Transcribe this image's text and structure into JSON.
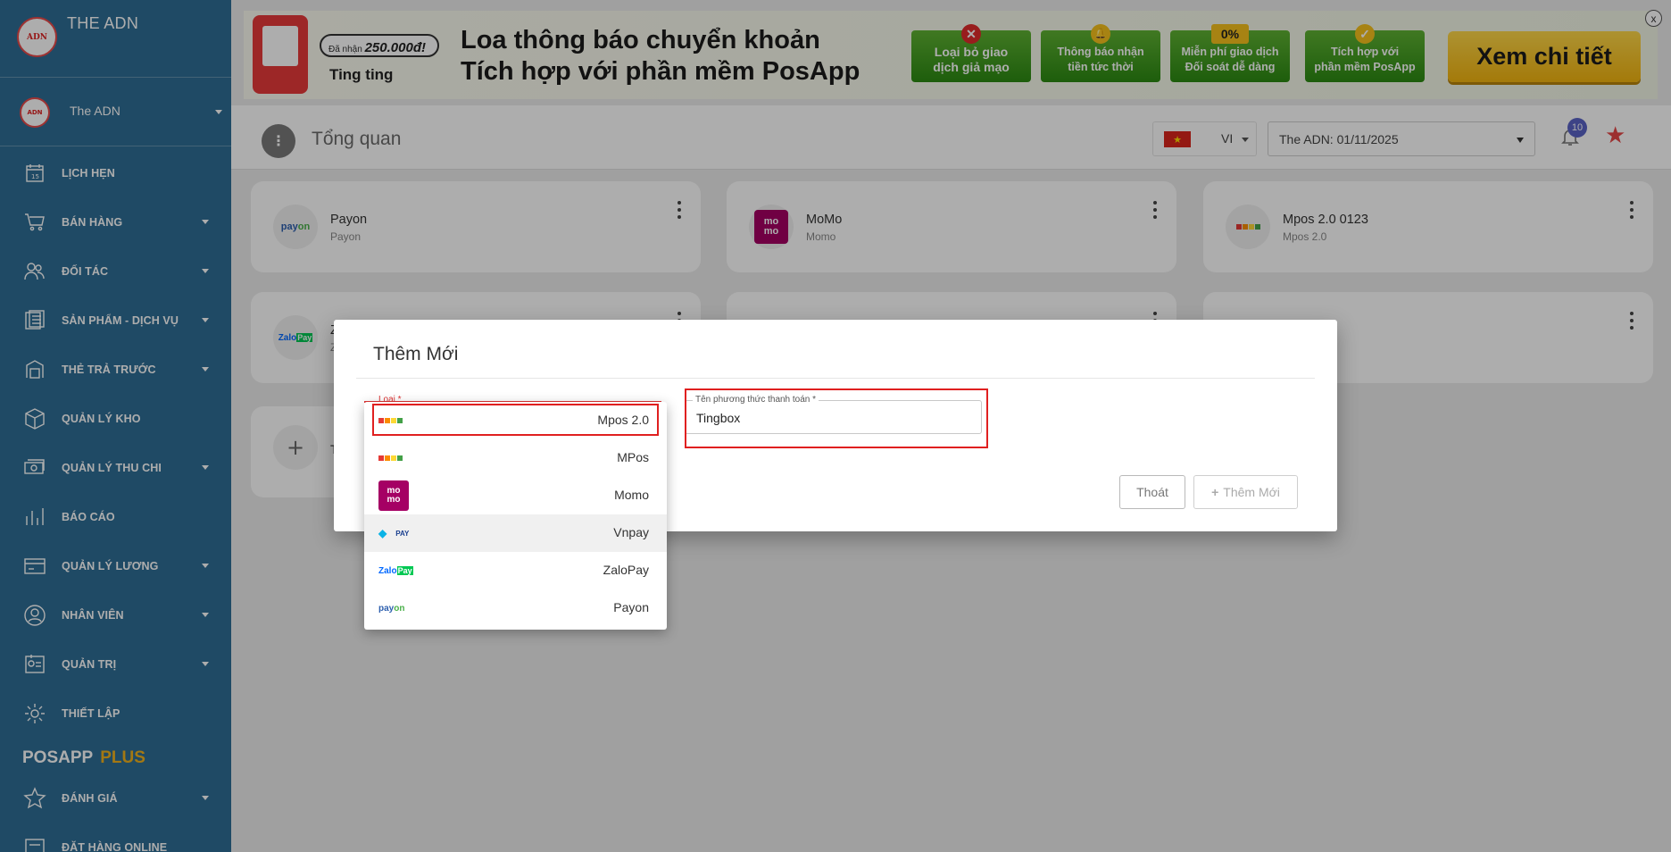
{
  "sidebar": {
    "brand_logo_text": "ADN",
    "brand_name": "THE ADN",
    "user_avatar_text": "ADN",
    "user_name": "The ADN",
    "items": [
      {
        "label": "LỊCH HẸN",
        "icon": "calendar-icon",
        "has_caret": false
      },
      {
        "label": "BÁN HÀNG",
        "icon": "cart-icon",
        "has_caret": true
      },
      {
        "label": "ĐỐI TÁC",
        "icon": "partners-icon",
        "has_caret": true
      },
      {
        "label": "SẢN PHẨM - DỊCH VỤ",
        "icon": "products-icon",
        "has_caret": true
      },
      {
        "label": "THẺ TRẢ TRƯỚC",
        "icon": "prepaid-card-icon",
        "has_caret": true
      },
      {
        "label": "QUẢN LÝ KHO",
        "icon": "warehouse-box-icon",
        "has_caret": false
      },
      {
        "label": "QUẢN LÝ THU CHI",
        "icon": "money-icon",
        "has_caret": true
      },
      {
        "label": "BÁO CÁO",
        "icon": "bar-chart-icon",
        "has_caret": false
      },
      {
        "label": "QUẢN LÝ LƯƠNG",
        "icon": "salary-card-icon",
        "has_caret": true
      },
      {
        "label": "NHÂN VIÊN",
        "icon": "user-icon",
        "has_caret": true
      },
      {
        "label": "QUẢN TRỊ",
        "icon": "admin-badge-icon",
        "has_caret": true
      },
      {
        "label": "THIẾT LẬP",
        "icon": "gear-icon",
        "has_caret": false
      }
    ],
    "posapp_label": "POSAPP",
    "posapp_plus": "PLUS",
    "items_after": [
      {
        "label": "ĐÁNH GIÁ",
        "icon": "star-outline-icon",
        "has_caret": true
      },
      {
        "label": "ĐẶT HÀNG ONLINE",
        "icon": "online-order-icon",
        "has_caret": false
      }
    ]
  },
  "banner": {
    "reward_prefix": "Đã nhận",
    "reward_amount": "250.000đ!",
    "tingting": "Ting ting",
    "headline_1": "Loa thông báo chuyển khoản",
    "headline_2": "Tích hợp với phần mềm PosApp",
    "features": [
      {
        "line1": "Loại bỏ giao",
        "line2": "dịch giả mạo",
        "badge": "✕"
      },
      {
        "line1": "Thông báo nhận",
        "line2": "tiền tức thời",
        "badge": "🔔"
      },
      {
        "line1": "Miễn phí giao dịch",
        "line2": "Đối soát dễ dàng",
        "badge": "0%"
      },
      {
        "line1": "Tích hợp với",
        "line2": "phần mềm PosApp",
        "badge": "✓"
      }
    ],
    "cta": "Xem chi tiết",
    "close": "x"
  },
  "topbar": {
    "title": "Tổng quan",
    "lang": "VI",
    "store": "The ADN: 01/11/2025",
    "notifications": "10"
  },
  "cards": [
    {
      "name": "Payon",
      "sub": "Payon",
      "logo": "payon"
    },
    {
      "name": "MoMo",
      "sub": "Momo",
      "logo": "momo"
    },
    {
      "name": "Mpos 2.0 0123",
      "sub": "Mpos 2.0",
      "logo": "mpos"
    },
    {
      "name": "Z",
      "sub": "Z",
      "logo": "zalopay"
    },
    {
      "name": "",
      "sub": "",
      "logo": ""
    },
    {
      "name": "",
      "sub": "",
      "logo": ""
    }
  ],
  "add_card_label": "T",
  "modal": {
    "title": "Thêm Mới",
    "type_label": "Loại *",
    "name_label": "Tên phương thức thanh toán *",
    "name_value": "Tingbox",
    "exit_label": "Thoát",
    "add_label": "Thêm Mới"
  },
  "dropdown": {
    "options": [
      {
        "label": "Mpos 2.0",
        "logo": "mpos",
        "selected": true
      },
      {
        "label": "MPos",
        "logo": "mpos",
        "selected": false
      },
      {
        "label": "Momo",
        "logo": "momo",
        "selected": false
      },
      {
        "label": "Vnpay",
        "logo": "vnpay",
        "selected": false,
        "hover": true
      },
      {
        "label": "ZaloPay",
        "logo": "zalopay",
        "selected": false
      },
      {
        "label": "Payon",
        "logo": "payon",
        "selected": false
      }
    ]
  },
  "logo_texts": {
    "momo": "mo mo",
    "payon": "payon",
    "zalopay": "ZaloPay",
    "vnpay": "PAY"
  },
  "colors": {
    "sidebar_bg": "#2f6e95",
    "accent_red": "#e02020",
    "plus_gold": "#f1b21c",
    "momo": "#a50064"
  }
}
